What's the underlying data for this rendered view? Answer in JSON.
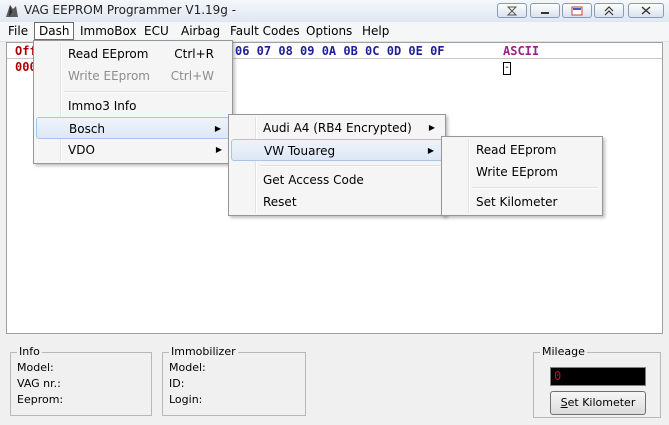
{
  "window": {
    "title": "VAG EEPROM Programmer  V1.19g -"
  },
  "menubar": {
    "items": [
      "File",
      "Dash",
      "ImmoBox",
      "ECU",
      "Airbag",
      "Fault Codes",
      "Options",
      "Help"
    ]
  },
  "hex": {
    "header_left": "Off",
    "header_cols": "06 07 08 09 0A 0B 0C 0D 0E 0F",
    "header_ascii": "ASCII",
    "row_left": "000",
    "cursor_char": "-"
  },
  "dash_menu": {
    "read_eeprom": "Read EEprom",
    "read_shortcut": "Ctrl+R",
    "write_eeprom": "Write EEprom",
    "write_shortcut": "Ctrl+W",
    "immo3_info": "Immo3 Info",
    "bosch": "Bosch",
    "vdo": "VDO"
  },
  "bosch_menu": {
    "audi_a4": "Audi A4 (RB4 Encrypted)",
    "vw_touareg": "VW Touareg",
    "get_access_code": "Get Access Code",
    "reset": "Reset"
  },
  "touareg_menu": {
    "read_eeprom": "Read EEprom",
    "write_eeprom": "Write EEprom",
    "set_kilometer": "Set Kilometer"
  },
  "info_panel": {
    "title": "Info",
    "model": "Model:",
    "vag_nr": "VAG nr.:",
    "eeprom": "Eeprom:"
  },
  "immobilizer_panel": {
    "title": "Immobilizer",
    "model": "Model:",
    "id": "ID:",
    "login": "Login:"
  },
  "mileage_panel": {
    "title": "Mileage",
    "value": "0",
    "button_label_u": "S",
    "button_label_rest": "et Kilometer"
  }
}
